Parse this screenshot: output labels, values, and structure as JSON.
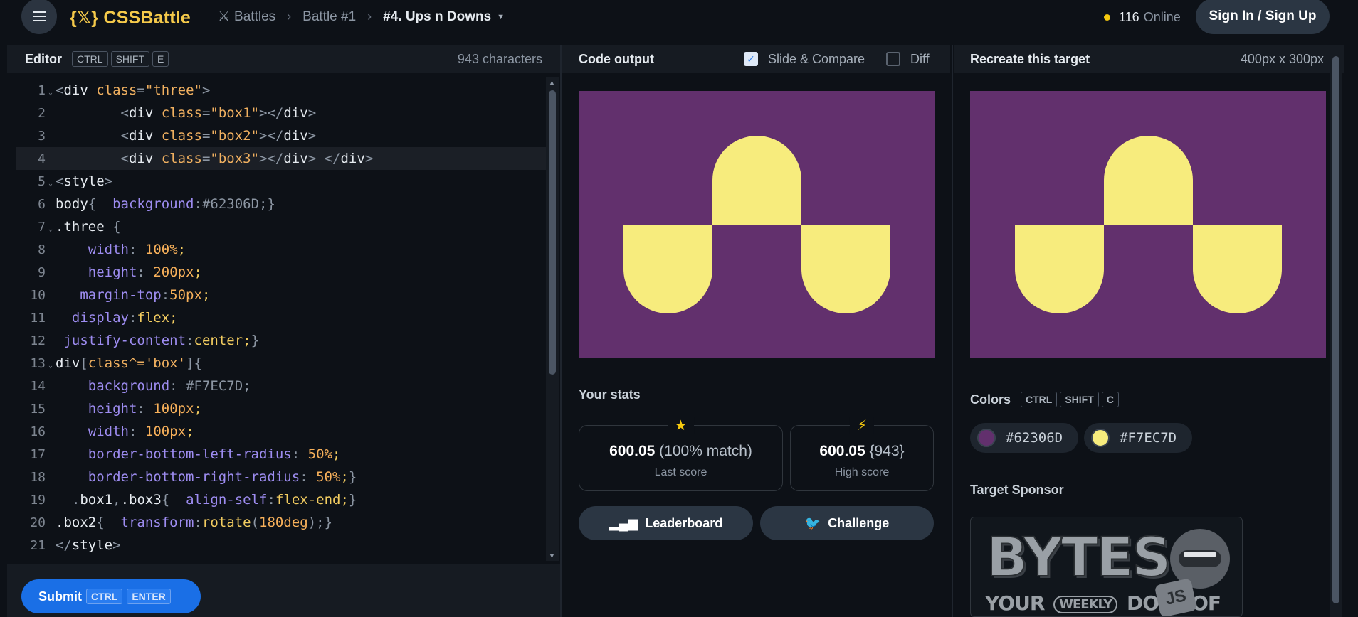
{
  "header": {
    "logo_brace": "{𝕏}",
    "logo_text": "CSSBattle",
    "breadcrumbs": [
      "Battles",
      "Battle #1",
      "#4. Ups n Downs"
    ],
    "online_count": "116",
    "online_label": "Online",
    "signin_label": "Sign In / Sign Up"
  },
  "editor": {
    "title": "Editor",
    "shortcut": [
      "CTRL",
      "SHIFT",
      "E"
    ],
    "char_count": "943 characters",
    "lines": [
      "1",
      "2",
      "3",
      "4",
      "5",
      "6",
      "7",
      "8",
      "9",
      "10",
      "11",
      "12",
      "13",
      "14",
      "15",
      "16",
      "17",
      "18",
      "19",
      "20",
      "21"
    ],
    "submit_label": "Submit",
    "submit_shortcut": [
      "CTRL",
      "ENTER"
    ]
  },
  "output": {
    "title": "Code output",
    "slide_compare_label": "Slide & Compare",
    "slide_compare_checked": true,
    "diff_label": "Diff",
    "diff_checked": false
  },
  "stats": {
    "title": "Your stats",
    "last_score": "600.05",
    "last_match": "(100% match)",
    "last_label": "Last score",
    "high_score": "600.05",
    "high_chars": "{943}",
    "high_label": "High score",
    "leaderboard_label": "Leaderboard",
    "challenge_label": "Challenge"
  },
  "target": {
    "title": "Recreate this target",
    "size": "400px x 300px",
    "colors_title": "Colors",
    "colors_shortcut": [
      "CTRL",
      "SHIFT",
      "C"
    ],
    "colors": [
      "#62306D",
      "#F7EC7D"
    ],
    "sponsor_title": "Target Sponsor",
    "sponsor_logo": "BYTES",
    "sponsor_tagline_1": "YOUR",
    "sponsor_tagline_2": "WEEKLY",
    "sponsor_tagline_3": "DOSE OF",
    "sponsor_js": "JS"
  },
  "icons": {
    "menu": "hamburger-icon",
    "battles": "crossed-swords-icon",
    "star": "star-icon",
    "bolt": "lightning-icon",
    "leaderboard": "bar-chart-icon",
    "challenge": "twitter-bird-icon"
  }
}
